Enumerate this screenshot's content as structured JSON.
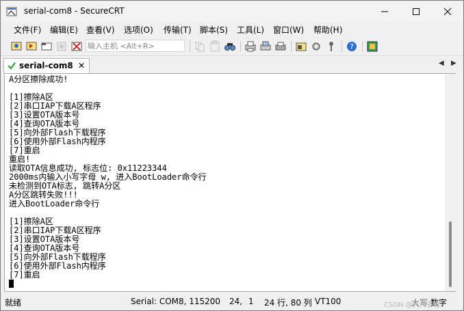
{
  "window": {
    "title": "serial-com8 - SecureCRT"
  },
  "menu": {
    "items": [
      "文件(F)",
      "编辑(E)",
      "查看(V)",
      "选项(O)",
      "传输(T)",
      "脚本(S)",
      "工具(L)",
      "窗口(W)",
      "帮助(H)"
    ]
  },
  "toolbar": {
    "host_placeholder": "输入主机 <Alt+R>"
  },
  "tab": {
    "label": "serial-com8"
  },
  "terminal": {
    "lines": [
      "A分区擦除成功!",
      "",
      "[1]擦除A区",
      "[2]串口IAP下载A区程序",
      "[3]设置OTA版本号",
      "[4]查询OTA版本号",
      "[5]向外部Flash下载程序",
      "[6]使用外部Flash内程序",
      "[7]重启",
      "重启!",
      "读取OTA信息成功, 标志位: 0x11223344",
      "2000ms内输入小写字母 w, 进入BootLoader命令行",
      "未检测到OTA标志, 跳转A分区",
      "A分区跳转失败!!!",
      "进入BootLoader命令行",
      "",
      "[1]擦除A区",
      "[2]串口IAP下载A区程序",
      "[3]设置OTA版本号",
      "[4]查询OTA版本号",
      "[5]向外部Flash下载程序",
      "[6]使用外部Flash内程序",
      "[7]重启"
    ]
  },
  "status": {
    "ready": "就绪",
    "serial": "Serial: COM8, 115200",
    "row": "24,",
    "col": "1",
    "rows_cols": "24 行, 80 列",
    "terminal_type": "VT100",
    "caps": "大写",
    "num": "数字"
  },
  "watermark": "CSDN @大大骆驼"
}
